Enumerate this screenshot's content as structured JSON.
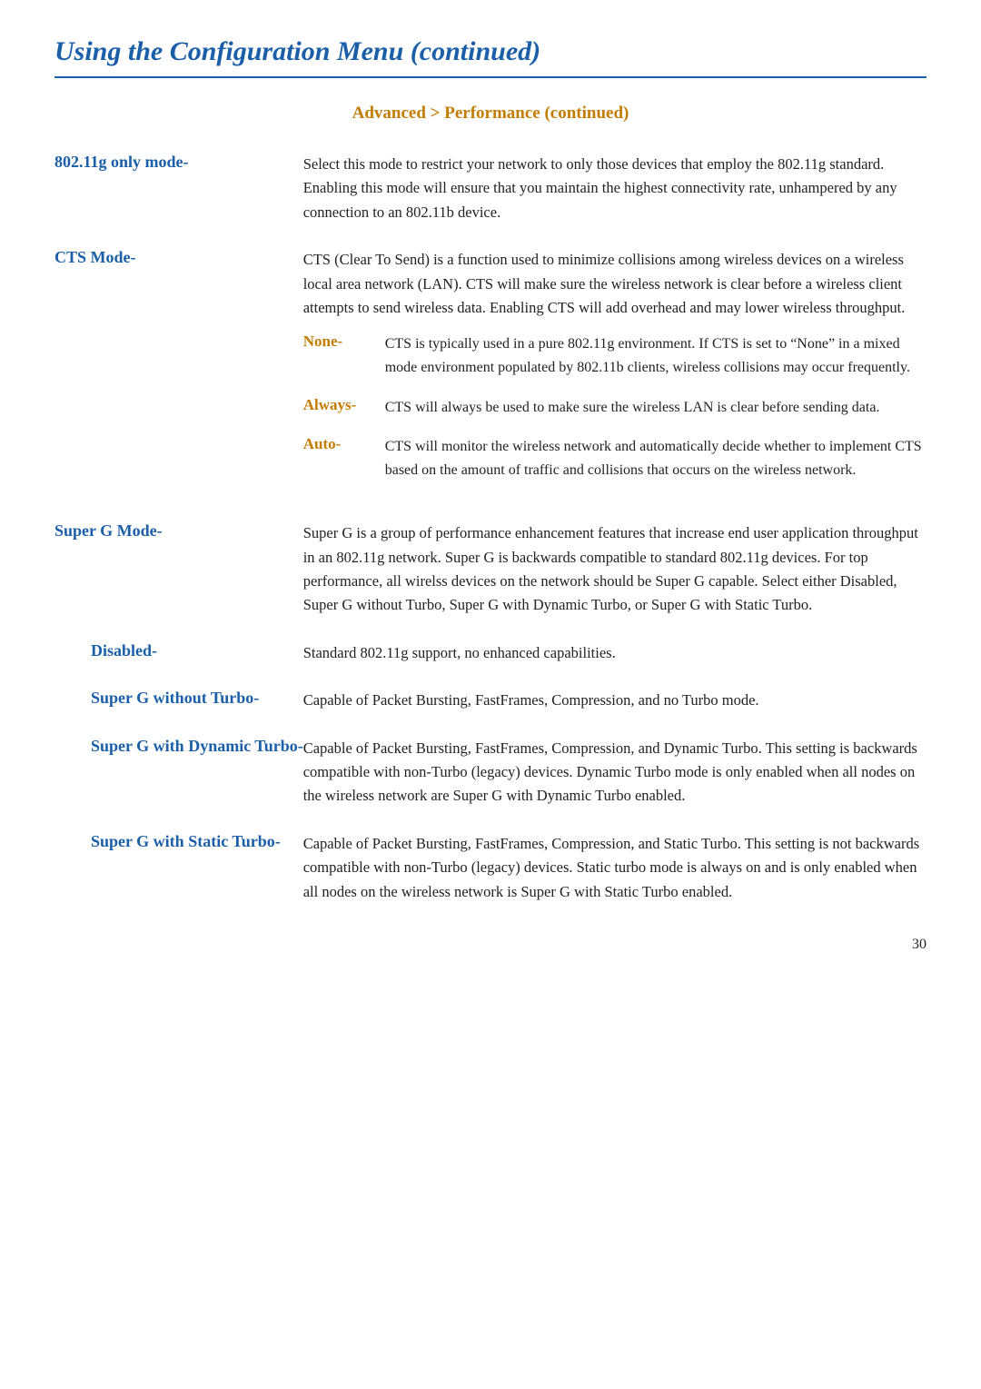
{
  "page": {
    "title": "Using the Configuration Menu (continued)",
    "section_heading": "Advanced > Performance (continued)",
    "page_number": "30"
  },
  "entries": [
    {
      "term": "802.11g only mode-",
      "body": "Select this mode to restrict your network to only those devices that employ the 802.11g standard. Enabling this mode will ensure that you maintain the highest connectivity rate, unhampered by any connection to an 802.11b device.",
      "sub_entries": []
    },
    {
      "term": "CTS  Mode-",
      "body": "CTS (Clear To Send) is a function used to minimize collisions among wireless devices on a wireless local area network (LAN). CTS will make sure the wireless network is clear before a wireless client attempts to send wireless data. Enabling CTS will add overhead and may lower wireless throughput.",
      "sub_entries": [
        {
          "sub_term": "None-",
          "sub_body": "CTS is typically used in a pure 802.11g environment. If CTS is set to “None” in a mixed mode environment populated by 802.11b clients, wireless collisions may occur frequently."
        },
        {
          "sub_term": "Always-",
          "sub_body": "CTS will always be used to make sure the wireless LAN is clear before sending data."
        },
        {
          "sub_term": "Auto-",
          "sub_body": "CTS will monitor the wireless network and automatically decide whether to implement CTS based on the amount of traffic and collisions that occurs on the wireless network."
        }
      ]
    },
    {
      "term": "Super G Mode-",
      "body": "Super G is a group of performance enhancement features that increase end user application throughput in an 802.11g network. Super G is backwards compatible to standard 802.11g devices. For top performance, all wirelss devices on the network should be Super G capable. Select either Disabled, Super G without Turbo, Super G with Dynamic Turbo, or Super G with Static Turbo.",
      "sub_entries": []
    },
    {
      "term": "Disabled-",
      "body": "Standard 802.11g support, no enhanced capabilities.",
      "sub_entries": [],
      "indent": true
    },
    {
      "term": "Super G without Turbo-",
      "body": "Capable of Packet Bursting, FastFrames, Compression, and no Turbo mode.",
      "sub_entries": [],
      "indent": true
    },
    {
      "term": "Super G with Dynamic Turbo-",
      "body": "Capable of Packet Bursting, FastFrames, Compression, and Dynamic Turbo. This setting is backwards compatible with non-Turbo (legacy) devices. Dynamic Turbo mode is only enabled when all nodes on the wireless network are Super G with Dynamic Turbo enabled.",
      "sub_entries": [],
      "indent": true
    },
    {
      "term": "Super G with Static Turbo-",
      "body": "Capable of Packet Bursting, FastFrames, Compression, and Static Turbo. This setting is not backwards compatible with non-Turbo (legacy) devices. Static turbo mode is always on and is only enabled when all nodes on the wireless network is Super G with Static Turbo enabled.",
      "sub_entries": [],
      "indent": true
    }
  ]
}
